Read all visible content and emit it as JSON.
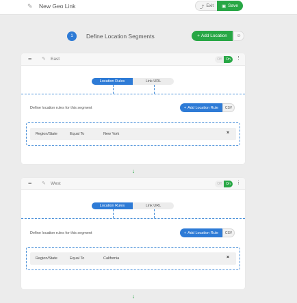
{
  "topbar": {
    "title": "New Geo Link",
    "exit_label": "Exit",
    "save_label": "Save"
  },
  "step": {
    "number": "1",
    "title": "Define Location Segments",
    "add_location_label": "Add Location"
  },
  "segments": [
    {
      "name": "East",
      "toggle_off": "Off",
      "toggle_on": "On",
      "tabs": [
        "Location Rules",
        "Link URL"
      ],
      "rules_label": "Define location rules for this segment",
      "add_rule_label": "Add Location Rule",
      "csv_label": "CSV",
      "rule": {
        "field": "Region/State",
        "operator": "Equal To",
        "value": "New York"
      }
    },
    {
      "name": "West",
      "toggle_off": "Off",
      "toggle_on": "On",
      "tabs": [
        "Location Rules",
        "Link URL"
      ],
      "rules_label": "Define location rules for this segment",
      "add_rule_label": "Add Location Rule",
      "csv_label": "CSV",
      "rule": {
        "field": "Region/State",
        "operator": "Equal To",
        "value": "California"
      }
    }
  ],
  "colors": {
    "primary_blue": "#2e7bd6",
    "success_green": "#28a745"
  }
}
